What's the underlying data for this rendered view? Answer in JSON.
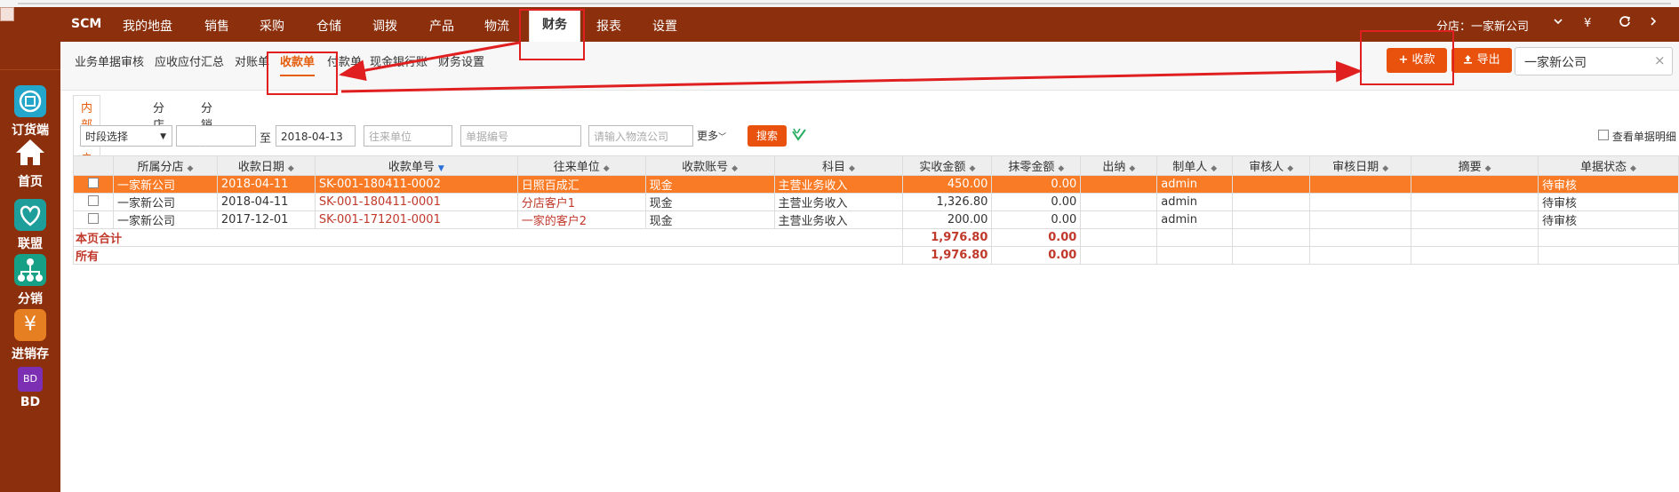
{
  "app": {
    "brand": "SCM"
  },
  "topnav": {
    "items": [
      "我的地盘",
      "销售",
      "采购",
      "仓储",
      "调拨",
      "产品",
      "物流",
      "财务",
      "报表",
      "设置"
    ],
    "active": "财务",
    "branch_label": "分店：一家新公司",
    "currency_symbol": "¥"
  },
  "sidebar": {
    "items": [
      {
        "label": "订货端",
        "icon": "order-icon"
      },
      {
        "label": "首页",
        "icon": "home-icon"
      },
      {
        "label": "联盟",
        "icon": "alliance-icon"
      },
      {
        "label": "分销",
        "icon": "distribution-icon"
      },
      {
        "label": "进销存",
        "icon": "yen-icon"
      },
      {
        "label": "BD",
        "icon": "bd-icon",
        "icon_text": "BD"
      }
    ]
  },
  "subnav": {
    "items": [
      "业务单据审核",
      "应收应付汇总",
      "对账单",
      "收款单",
      "付款单",
      "现金银行账",
      "财务设置"
    ],
    "active": "收款单",
    "add_button": "收款",
    "export_button": "导出",
    "company_select": "一家新公司"
  },
  "tabs": [
    "内部客户",
    "分店",
    "分销商"
  ],
  "filter": {
    "period": "时段选择",
    "date_from": "",
    "to_label": "至",
    "date_to": "2018-04-13",
    "partner_placeholder": "往来单位",
    "doc_no_placeholder": "单据编号",
    "logistics_placeholder": "请输入物流公司",
    "more": "更多",
    "search": "搜索",
    "view_detail": "查看单据明细"
  },
  "table": {
    "headers": [
      "所属分店",
      "收款日期",
      "收款单号",
      "往来单位",
      "收款账号",
      "科目",
      "实收金额",
      "抹零金额",
      "出纳",
      "制单人",
      "审核人",
      "审核日期",
      "摘要",
      "单据状态"
    ],
    "rows": [
      [
        "一家新公司",
        "2018-04-11",
        "SK-001-180411-0002",
        "日照百成汇",
        "现金",
        "主营业务收入",
        "450.00",
        "0.00",
        "",
        "admin",
        "",
        "",
        "",
        "待审核"
      ],
      [
        "一家新公司",
        "2018-04-11",
        "SK-001-180411-0001",
        "分店客户1",
        "现金",
        "主营业务收入",
        "1,326.80",
        "0.00",
        "",
        "admin",
        "",
        "",
        "",
        "待审核"
      ],
      [
        "一家新公司",
        "2017-12-01",
        "SK-001-171201-0001",
        "一家的客户2",
        "现金",
        "主营业务收入",
        "200.00",
        "0.00",
        "",
        "admin",
        "",
        "",
        "",
        "待审核"
      ]
    ],
    "page_total_label": "本页合计",
    "page_total_amount": "1,976.80",
    "page_total_zero": "0.00",
    "all_label": "所有",
    "all_amount": "1,976.80",
    "all_zero": "0.00"
  },
  "colors": {
    "header_bg": "#8b2f0c",
    "accent": "#e8520c",
    "selected_row": "#f97b26",
    "annotation": "#e02020"
  }
}
